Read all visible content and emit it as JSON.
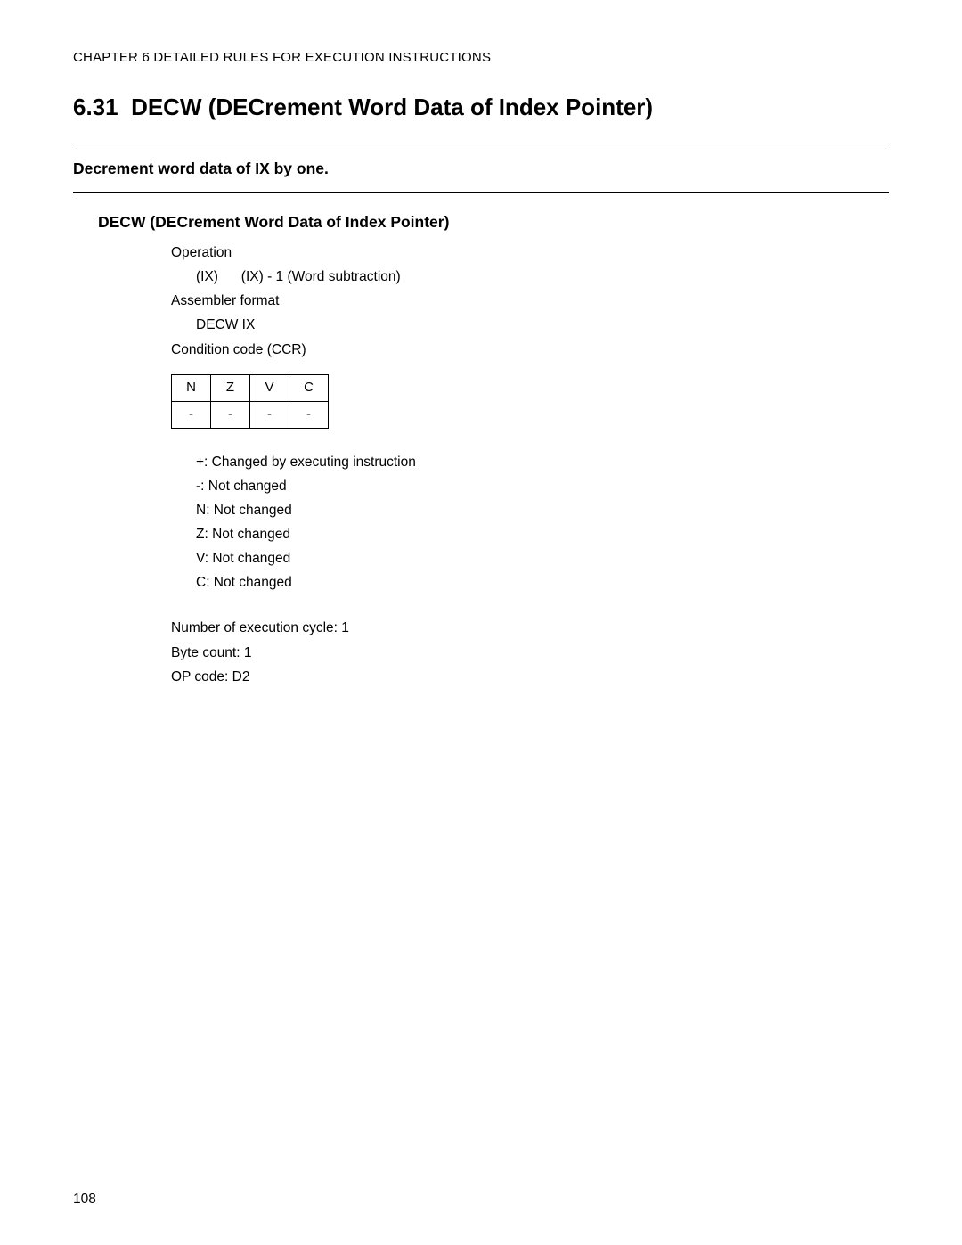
{
  "header": {
    "chapter": "CHAPTER 6  DETAILED RULES FOR EXECUTION INSTRUCTIONS"
  },
  "section": {
    "number": "6.31",
    "title": "DECW (DECrement Word Data of Index Pointer)"
  },
  "summary": "Decrement word data of IX by one.",
  "subsection_title": "DECW (DECrement Word Data of Index Pointer)",
  "operation": {
    "label": "Operation",
    "value": "(IX)      (IX) - 1 (Word subtraction)"
  },
  "assembler": {
    "label": "Assembler format",
    "value": "DECW IX"
  },
  "ccr": {
    "label": "Condition code (CCR)",
    "headers": [
      "N",
      "Z",
      "V",
      "C"
    ],
    "values": [
      "-",
      "-",
      "-",
      "-"
    ]
  },
  "legend": {
    "plus": "+: Changed by executing instruction",
    "minus": "-: Not changed",
    "n": "N: Not changed",
    "z": "Z: Not changed",
    "v": "V: Not changed",
    "c": "C: Not changed"
  },
  "exec_cycle": "Number of execution cycle: 1",
  "byte_count": "Byte count: 1",
  "op_code": "OP code: D2",
  "page_number": "108"
}
